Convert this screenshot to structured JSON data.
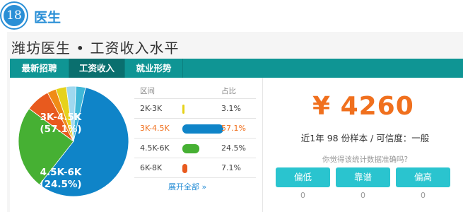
{
  "section": {
    "number": "18",
    "title": "医生"
  },
  "panel_title": "潍坊医生 • 工资收入水平",
  "tabs": [
    "最新招聘",
    "工资收入",
    "就业形势"
  ],
  "table": {
    "headers": {
      "range": "区间",
      "share": "占比"
    },
    "rows": [
      {
        "range": "2K-3K",
        "share": "3.1%",
        "color": "#e6d21a",
        "active": false
      },
      {
        "range": "3K-4.5K",
        "share": "57.1%",
        "color": "#0f84c8",
        "active": true
      },
      {
        "range": "4.5K-6K",
        "share": "24.5%",
        "color": "#46b033",
        "active": false
      },
      {
        "range": "6K-8K",
        "share": "7.1%",
        "color": "#e85a1e",
        "active": false
      }
    ],
    "expand_label": "展开全部 »"
  },
  "pie_labels": {
    "big_range": "3K-4.5K",
    "big_pct": "(57.1%)",
    "mid_range": "4.5K-6K",
    "mid_pct": "(24.5%)"
  },
  "chart_data": {
    "type": "pie",
    "slices": [
      {
        "label": "3K-4.5K",
        "value": 57.1,
        "color": "#0f84c8"
      },
      {
        "label": "4.5K-6K",
        "value": 24.5,
        "color": "#46b033"
      },
      {
        "label": "6K-8K",
        "value": 7.1,
        "color": "#e85a1e"
      },
      {
        "label": "",
        "value": 2.6,
        "color": "#f08c16"
      },
      {
        "label": "2K-3K",
        "value": 3.1,
        "color": "#e6d21a"
      },
      {
        "label": "",
        "value": 2.8,
        "color": "#9fd8ef"
      },
      {
        "label": "",
        "value": 2.8,
        "color": "#40b8d8"
      }
    ]
  },
  "summary": {
    "salary": "¥ 4260",
    "sample_text": "近1年 98 份样本 / 可信度：一般",
    "question": "你觉得该统计数据准确吗?"
  },
  "votes": [
    {
      "label": "偏低",
      "count": "0"
    },
    {
      "label": "靠谱",
      "count": "0"
    },
    {
      "label": "偏高",
      "count": "0"
    }
  ]
}
